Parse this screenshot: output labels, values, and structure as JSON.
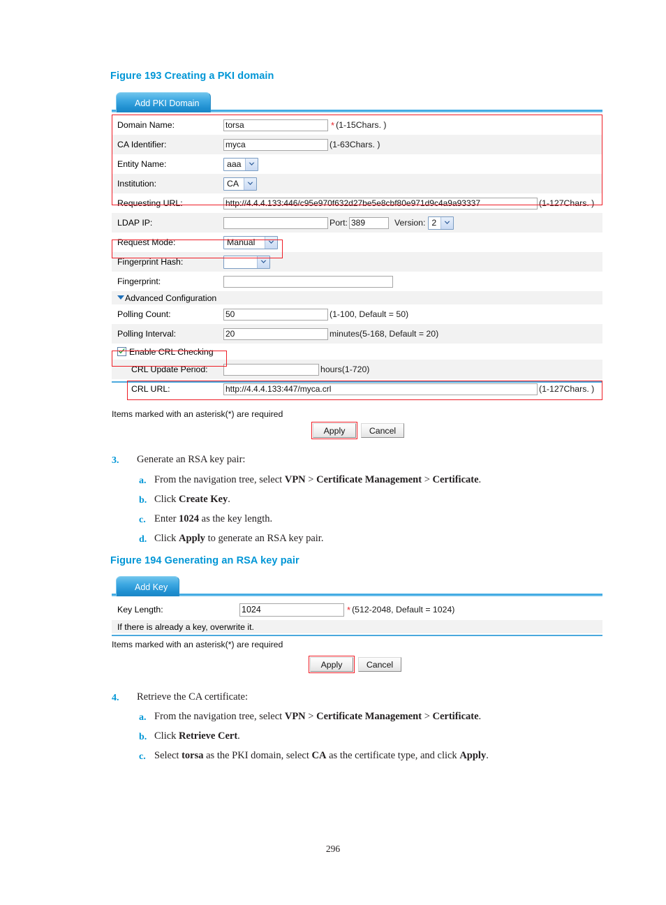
{
  "page": {
    "number": "296"
  },
  "figure193": {
    "caption": "Figure 193 Creating a PKI domain",
    "tab_label": "Add PKI Domain",
    "rows": [
      {
        "label": "Domain Name:",
        "value": "torsa",
        "hint": "(1-15Chars. )",
        "required": true
      },
      {
        "label": "CA Identifier:",
        "value": "myca",
        "hint": "(1-63Chars. )",
        "required": false
      },
      {
        "label": "Entity Name:",
        "value": "aaa",
        "hint": "",
        "required": false
      },
      {
        "label": "Institution:",
        "value": "CA",
        "hint": "",
        "required": false
      },
      {
        "label": "Requesting URL:",
        "value": "http://4.4.4.133:446/c95e970f632d27be5e8cbf80e971d9c4a9a93337",
        "hint": "(1-127Chars. )",
        "required": false
      },
      {
        "label": "LDAP IP:",
        "value": "",
        "hint": "",
        "required": false
      },
      {
        "label": "Request Mode:",
        "value": "Manual",
        "hint": "",
        "required": false
      },
      {
        "label": "Fingerprint Hash:",
        "value": "",
        "hint": "",
        "required": false
      },
      {
        "label": "Fingerprint:",
        "value": "",
        "hint": "",
        "required": false
      },
      {
        "label": "Polling Count:",
        "value": "50",
        "hint": "(1-100, Default = 50)",
        "required": false
      },
      {
        "label": "Polling Interval:",
        "value": "20",
        "hint": "minutes(5-168, Default = 20)",
        "required": false
      },
      {
        "label": "CRL Update Period:",
        "value": "",
        "hint": "hours(1-720)",
        "required": false
      },
      {
        "label": "CRL URL:",
        "value": "http://4.4.4.133:447/myca.crl",
        "hint": "(1-127Chars. )",
        "required": false
      }
    ],
    "ldap_port_label": "Port:",
    "ldap_port_value": "389",
    "ldap_version_label": "Version:",
    "ldap_version_value": "2",
    "advanced_label": "Advanced Configuration",
    "crl_checkbox_label": "Enable CRL Checking",
    "crl_checkbox_checked": true,
    "required_note": "Items marked with an asterisk(*) are required",
    "apply_label": "Apply",
    "cancel_label": "Cancel"
  },
  "figure194": {
    "caption": "Figure 194 Generating an RSA key pair",
    "tab_label": "Add Key",
    "key_length_label": "Key Length:",
    "key_length_value": "1024",
    "key_length_hint": "(512-2048, Default = 1024)",
    "overwrite_note": "If there is already a key, overwrite it.",
    "required_note": "Items marked with an asterisk(*) are required",
    "apply_label": "Apply",
    "cancel_label": "Cancel"
  },
  "step3": {
    "num": "3.",
    "title": "Generate an RSA key pair:",
    "items": [
      {
        "marker": "a.",
        "pre": "From the navigation tree, select ",
        "b1": "VPN",
        "mid1": " > ",
        "b2": "Certificate Management",
        "mid2": " > ",
        "b3": "Certificate",
        "post": "."
      },
      {
        "marker": "b.",
        "pre": "Click ",
        "b1": "Create Key",
        "mid1": "",
        "b2": "",
        "mid2": "",
        "b3": "",
        "post": "."
      },
      {
        "marker": "c.",
        "pre": "Enter ",
        "b1": "1024",
        "mid1": " as the key length.",
        "b2": "",
        "mid2": "",
        "b3": "",
        "post": ""
      },
      {
        "marker": "d.",
        "pre": "Click ",
        "b1": "Apply",
        "mid1": " to generate an RSA key pair.",
        "b2": "",
        "mid2": "",
        "b3": "",
        "post": ""
      }
    ]
  },
  "step4": {
    "num": "4.",
    "title": "Retrieve the CA certificate:",
    "items": [
      {
        "marker": "a.",
        "pre": "From the navigation tree, select ",
        "b1": "VPN",
        "mid1": " > ",
        "b2": "Certificate Management",
        "mid2": " > ",
        "b3": "Certificate",
        "post": "."
      },
      {
        "marker": "b.",
        "pre": "Click ",
        "b1": "Retrieve Cert",
        "mid1": "",
        "b2": "",
        "mid2": "",
        "b3": "",
        "post": "."
      },
      {
        "marker": "c.",
        "pre": "Select ",
        "b1": "torsa",
        "mid1": " as the PKI domain, select ",
        "b2": "CA",
        "mid2": " as the certificate type, and click ",
        "b3": "Apply",
        "post": "."
      }
    ]
  },
  "colors": {
    "caption_blue": "#0096d6",
    "annotation_red": "#ee1c25",
    "tab_blue": "#3ea8e2",
    "row_grey": "#f2f2f2",
    "required_star": "#e8262b"
  }
}
